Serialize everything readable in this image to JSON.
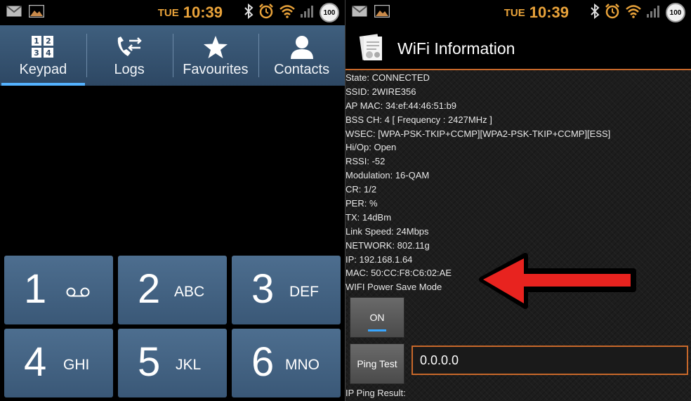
{
  "status_bar": {
    "day": "TUE",
    "time": "10:39",
    "battery": "100"
  },
  "phone": {
    "tabs": [
      {
        "label": "Keypad",
        "active": true
      },
      {
        "label": "Logs",
        "active": false
      },
      {
        "label": "Favourites",
        "active": false
      },
      {
        "label": "Contacts",
        "active": false
      }
    ],
    "keys": [
      {
        "num": "1",
        "letters": ""
      },
      {
        "num": "2",
        "letters": "ABC"
      },
      {
        "num": "3",
        "letters": "DEF"
      },
      {
        "num": "4",
        "letters": "GHI"
      },
      {
        "num": "5",
        "letters": "JKL"
      },
      {
        "num": "6",
        "letters": "MNO"
      }
    ]
  },
  "wifi": {
    "title": "WiFi Information",
    "lines": [
      "State: CONNECTED",
      "SSID: 2WIRE356",
      "AP MAC: 34:ef:44:46:51:b9",
      "BSS CH: 4  [ Frequency : 2427MHz ]",
      "WSEC: [WPA-PSK-TKIP+CCMP][WPA2-PSK-TKIP+CCMP][ESS]",
      "Hi/Op: Open",
      "RSSI: -52",
      "Modulation: 16-QAM",
      "CR: 1/2",
      "PER:  %",
      "TX: 14dBm",
      "Link Speed: 24Mbps",
      "NETWORK: 802.11g",
      "IP: 192.168.1.64",
      "MAC: 50:CC:F8:C6:02:AE",
      "WIFI Power Save Mode"
    ],
    "power_save_button": "ON",
    "ping_button": "Ping Test",
    "ping_input_value": "0.0.0.0",
    "ping_result_label": "IP Ping Result:"
  },
  "colors": {
    "accent": "#e8a23a",
    "tab_active": "#54b2ff",
    "field_border": "#c8682a",
    "arrow": "#e8231f"
  }
}
